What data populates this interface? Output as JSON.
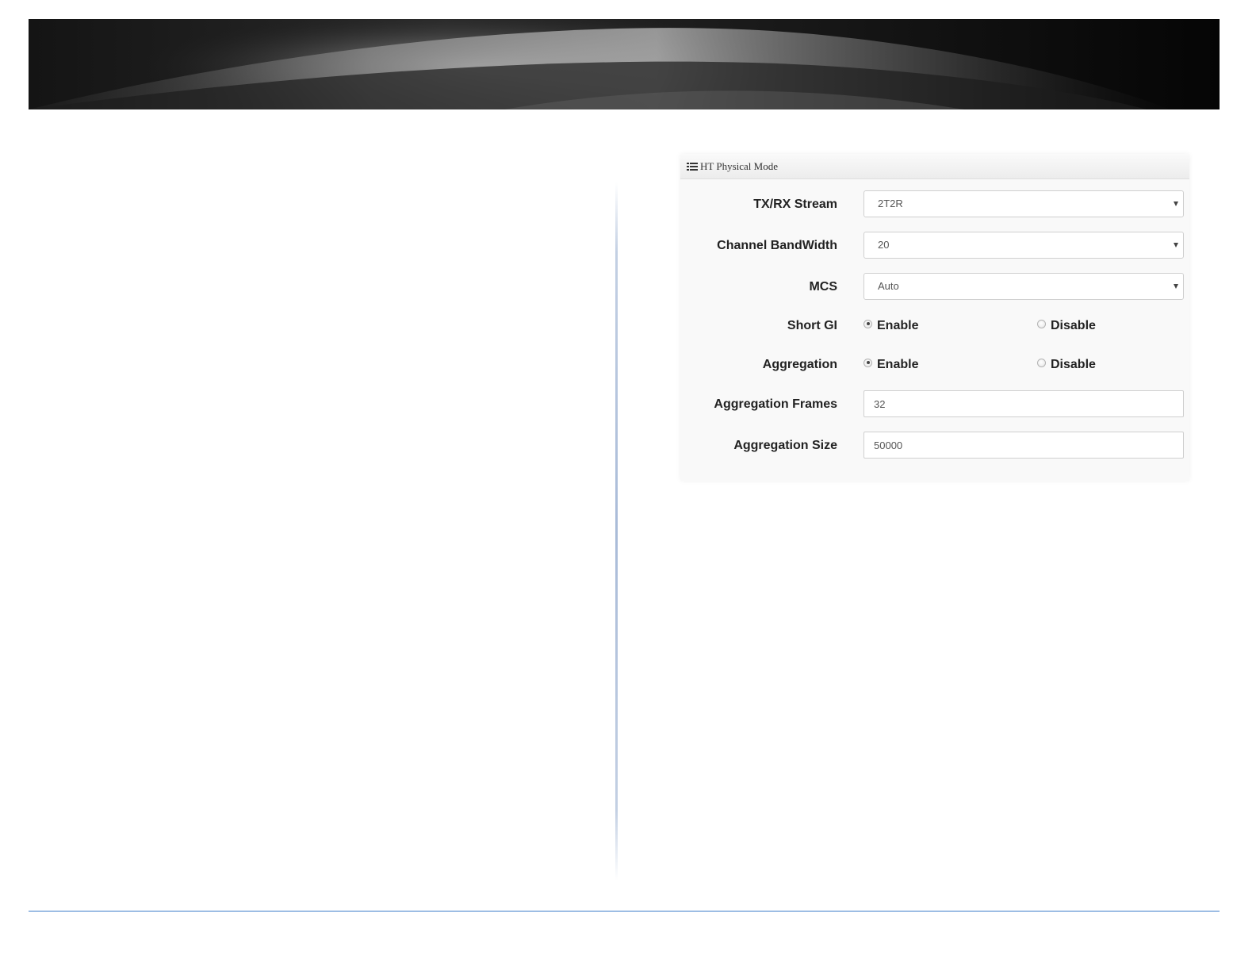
{
  "panel": {
    "title": "HT Physical Mode",
    "title_icon": "list-icon"
  },
  "fields": {
    "tx_rx_stream": {
      "label": "TX/RX Stream",
      "value": "2T2R"
    },
    "channel_bandwidth": {
      "label": "Channel BandWidth",
      "value": "20"
    },
    "mcs": {
      "label": "MCS",
      "value": "Auto"
    },
    "short_gi": {
      "label": "Short GI",
      "enable_label": "Enable",
      "disable_label": "Disable",
      "selected": "Enable"
    },
    "aggregation": {
      "label": "Aggregation",
      "enable_label": "Enable",
      "disable_label": "Disable",
      "selected": "Enable"
    },
    "aggregation_frames": {
      "label": "Aggregation Frames",
      "value": "32"
    },
    "aggregation_size": {
      "label": "Aggregation Size",
      "value": "50000"
    }
  },
  "colors": {
    "footer_line": "#3d7cc9",
    "banner_dark": "#0b0b0b"
  }
}
